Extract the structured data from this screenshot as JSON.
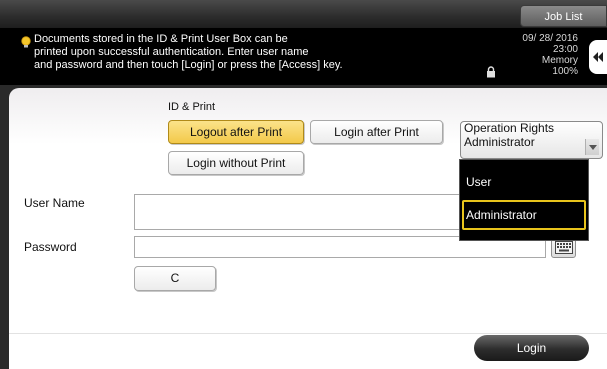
{
  "header": {
    "job_list_label": "Job List"
  },
  "message": {
    "line1": "Documents stored in the ID & Print User Box can be",
    "line2": "printed upon successful authentication. Enter user name",
    "line3": "and password and then touch [Login] or press the [Access] key.",
    "icon": "lightbulb-icon"
  },
  "status": {
    "date": "09/ 28/ 2016",
    "time": "23:00",
    "memory_label": "Memory",
    "memory_value": "100%"
  },
  "id_print": {
    "section_label": "ID & Print",
    "logout_after_print": "Logout after Print",
    "login_after_print": "Login after Print",
    "login_without_print": "Login without Print"
  },
  "form": {
    "user_name_label": "User Name",
    "user_name_value": "",
    "password_label": "Password",
    "password_value": "",
    "clear_label": "C"
  },
  "operation_rights": {
    "label": "Operation Rights",
    "selected": "Administrator",
    "options": [
      "User",
      "Administrator"
    ]
  },
  "footer": {
    "login_label": "Login"
  },
  "colors": {
    "selected_button": "#f3c94a",
    "selection_outline": "#e8c41c",
    "message_background": "#000000"
  }
}
